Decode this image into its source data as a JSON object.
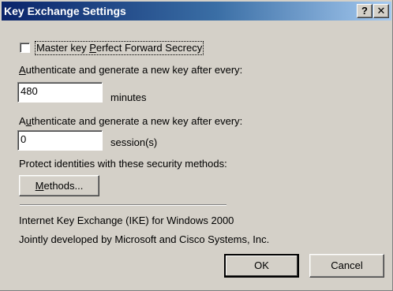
{
  "window": {
    "title": "Key Exchange Settings",
    "help_glyph": "?",
    "close_glyph": "✕"
  },
  "pfs": {
    "label": "Master key Perfect Forward Secrecy",
    "checked": false
  },
  "key_time": {
    "prompt_pre": "",
    "prompt_accel": "A",
    "prompt_post": "uthenticate and generate a new key after every:",
    "value": "480",
    "unit": "minutes"
  },
  "key_sessions": {
    "prompt_pre": "A",
    "prompt_accel": "u",
    "prompt_post": "thenticate and generate a new key after every:",
    "value": "0",
    "unit": "session(s)"
  },
  "security": {
    "prompt": "Protect identities with these security methods:",
    "methods_accel": "M",
    "methods_rest": "ethods..."
  },
  "info": {
    "line1": "Internet Key Exchange (IKE) for Windows 2000",
    "line2": "Jointly developed by Microsoft and Cisco Systems, Inc."
  },
  "buttons": {
    "ok": "OK",
    "cancel": "Cancel"
  }
}
